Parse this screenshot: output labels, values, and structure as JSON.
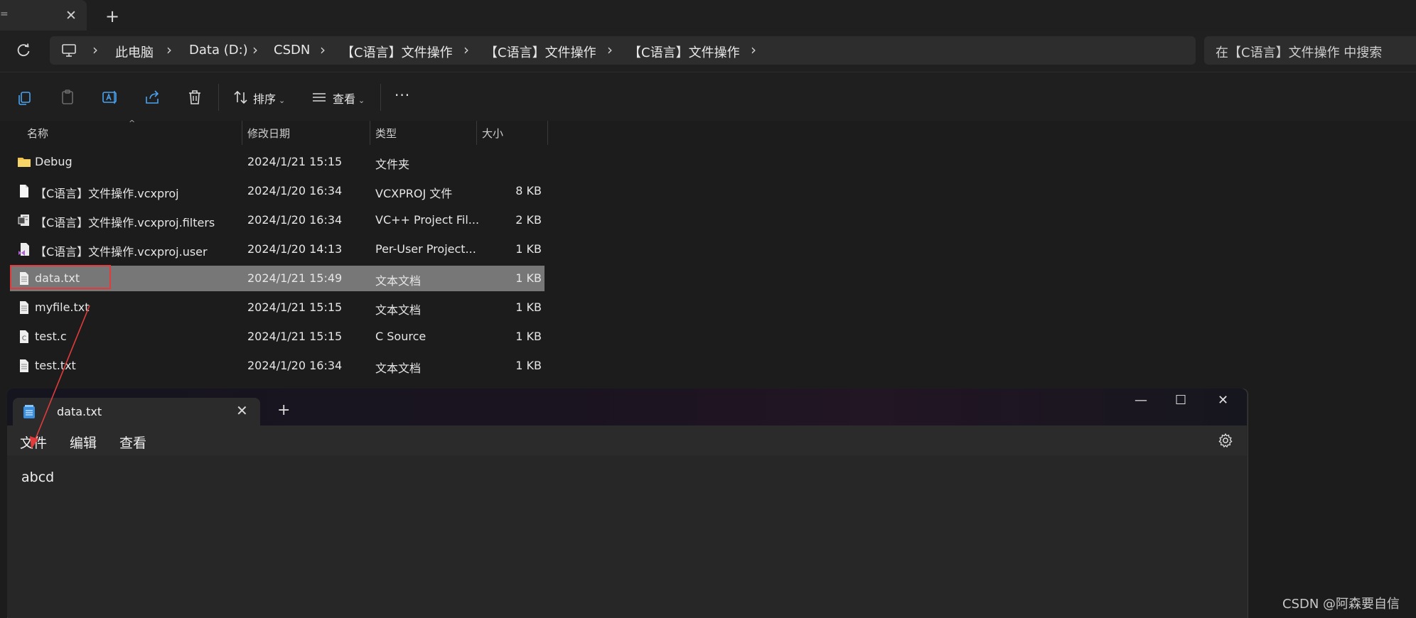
{
  "explorer": {
    "tab_edge": "=",
    "tab_close": "✕",
    "new_tab": "+",
    "breadcrumbs": [
      "此电脑",
      "Data (D:)",
      "CSDN",
      "【C语言】文件操作",
      "【C语言】文件操作",
      "【C语言】文件操作"
    ],
    "separator": "›",
    "search_placeholder": "在【C语言】文件操作 中搜索",
    "toolbar": {
      "sort_label": "排序",
      "view_label": "查看",
      "more_label": "···"
    },
    "columns": [
      "名称",
      "修改日期",
      "类型",
      "大小"
    ],
    "files": [
      {
        "name": "Debug",
        "date": "2024/1/21 15:15",
        "type": "文件夹",
        "size": "",
        "icon": "folder-icon"
      },
      {
        "name": "【C语言】文件操作.vcxproj",
        "date": "2024/1/20 16:34",
        "type": "VCXPROJ 文件",
        "size": "8 KB",
        "icon": "file-icon"
      },
      {
        "name": "【C语言】文件操作.vcxproj.filters",
        "date": "2024/1/20 16:34",
        "type": "VC++ Project Fil...",
        "size": "2 KB",
        "icon": "filters-file-icon"
      },
      {
        "name": "【C语言】文件操作.vcxproj.user",
        "date": "2024/1/20 14:13",
        "type": "Per-User Project...",
        "size": "1 KB",
        "icon": "vs-user-file-icon"
      },
      {
        "name": "data.txt",
        "date": "2024/1/21 15:49",
        "type": "文本文档",
        "size": "1 KB",
        "icon": "text-file-icon",
        "selected": true
      },
      {
        "name": "myfile.txt",
        "date": "2024/1/21 15:15",
        "type": "文本文档",
        "size": "1 KB",
        "icon": "text-file-icon"
      },
      {
        "name": "test.c",
        "date": "2024/1/21 15:15",
        "type": "C Source",
        "size": "1 KB",
        "icon": "c-source-icon"
      },
      {
        "name": "test.txt",
        "date": "2024/1/20 16:34",
        "type": "文本文档",
        "size": "1 KB",
        "icon": "text-file-icon"
      }
    ]
  },
  "notepad": {
    "tab_title": "data.txt",
    "tab_close": "✕",
    "new_tab": "+",
    "minimize": "—",
    "maximize": "☐",
    "close": "✕",
    "menu": [
      "文件",
      "编辑",
      "查看"
    ],
    "content": "abcd"
  },
  "colors": {
    "selected_row": "#777777",
    "highlight_box": "#e23b3b",
    "arrow": "#e23b3b"
  },
  "watermark": "CSDN @阿森要自信"
}
